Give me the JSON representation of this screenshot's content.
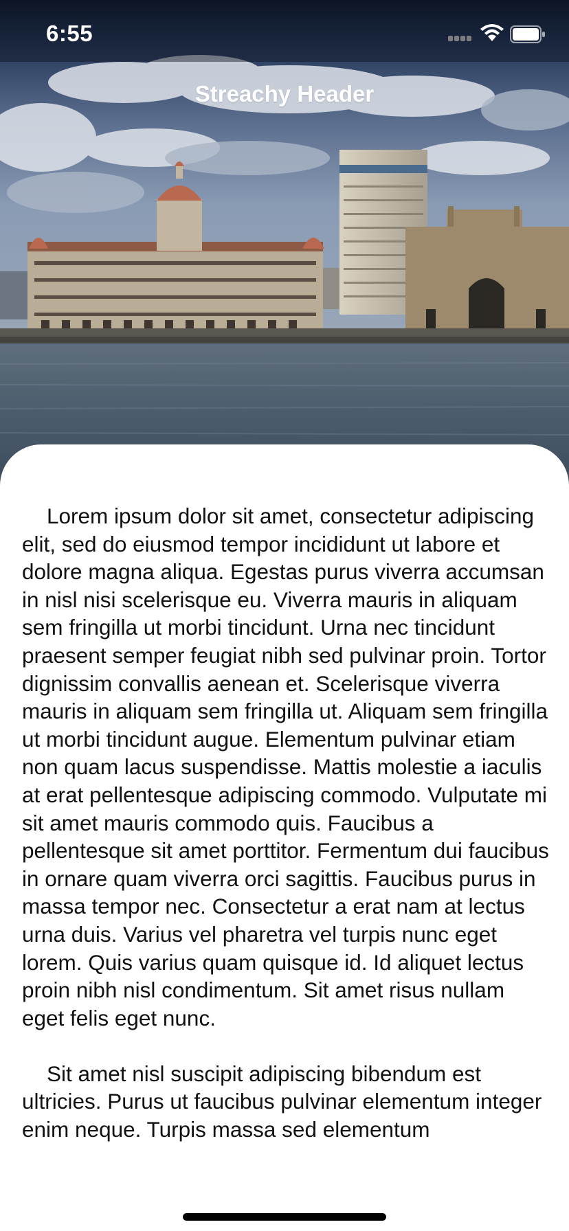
{
  "status_bar": {
    "time": "6:55",
    "signal_icon": "signal-bars-icon",
    "wifi_icon": "wifi-icon",
    "battery_icon": "battery-icon"
  },
  "navigation": {
    "title": "Streachy Header"
  },
  "header_image": {
    "subject": "photo-of-waterfront-skyline"
  },
  "content": {
    "paragraphs": [
      "Lorem ipsum dolor sit amet, consectetur adipiscing elit, sed do eiusmod tempor incididunt ut labore et dolore magna aliqua. Egestas purus viverra accumsan in nisl nisi scelerisque eu. Viverra mauris in aliquam sem fringilla ut morbi tincidunt. Urna nec tincidunt praesent semper feugiat nibh sed pulvinar proin. Tortor dignissim convallis aenean et. Scelerisque viverra mauris in aliquam sem fringilla ut. Aliquam sem fringilla ut morbi tincidunt augue. Elementum pulvinar etiam non quam lacus suspendisse. Mattis molestie a iaculis at erat pellentesque adipiscing commodo. Vulputate mi sit amet mauris commodo quis. Faucibus a pellentesque sit amet porttitor. Fermentum dui faucibus in ornare quam viverra orci sagittis. Faucibus purus in massa tempor nec. Consectetur a erat nam at lectus urna duis. Varius vel pharetra vel turpis nunc eget lorem. Quis varius quam quisque id. Id aliquet lectus proin nibh nisl condimentum. Sit amet risus nullam eget felis eget nunc.",
      "Sit amet nisl suscipit adipiscing bibendum est ultricies. Purus ut faucibus pulvinar elementum integer enim neque. Turpis massa sed elementum"
    ]
  },
  "colors": {
    "sky": "#5b6f8c",
    "water": "#4a5a6a",
    "card": "#ffffff",
    "text": "#111111"
  }
}
